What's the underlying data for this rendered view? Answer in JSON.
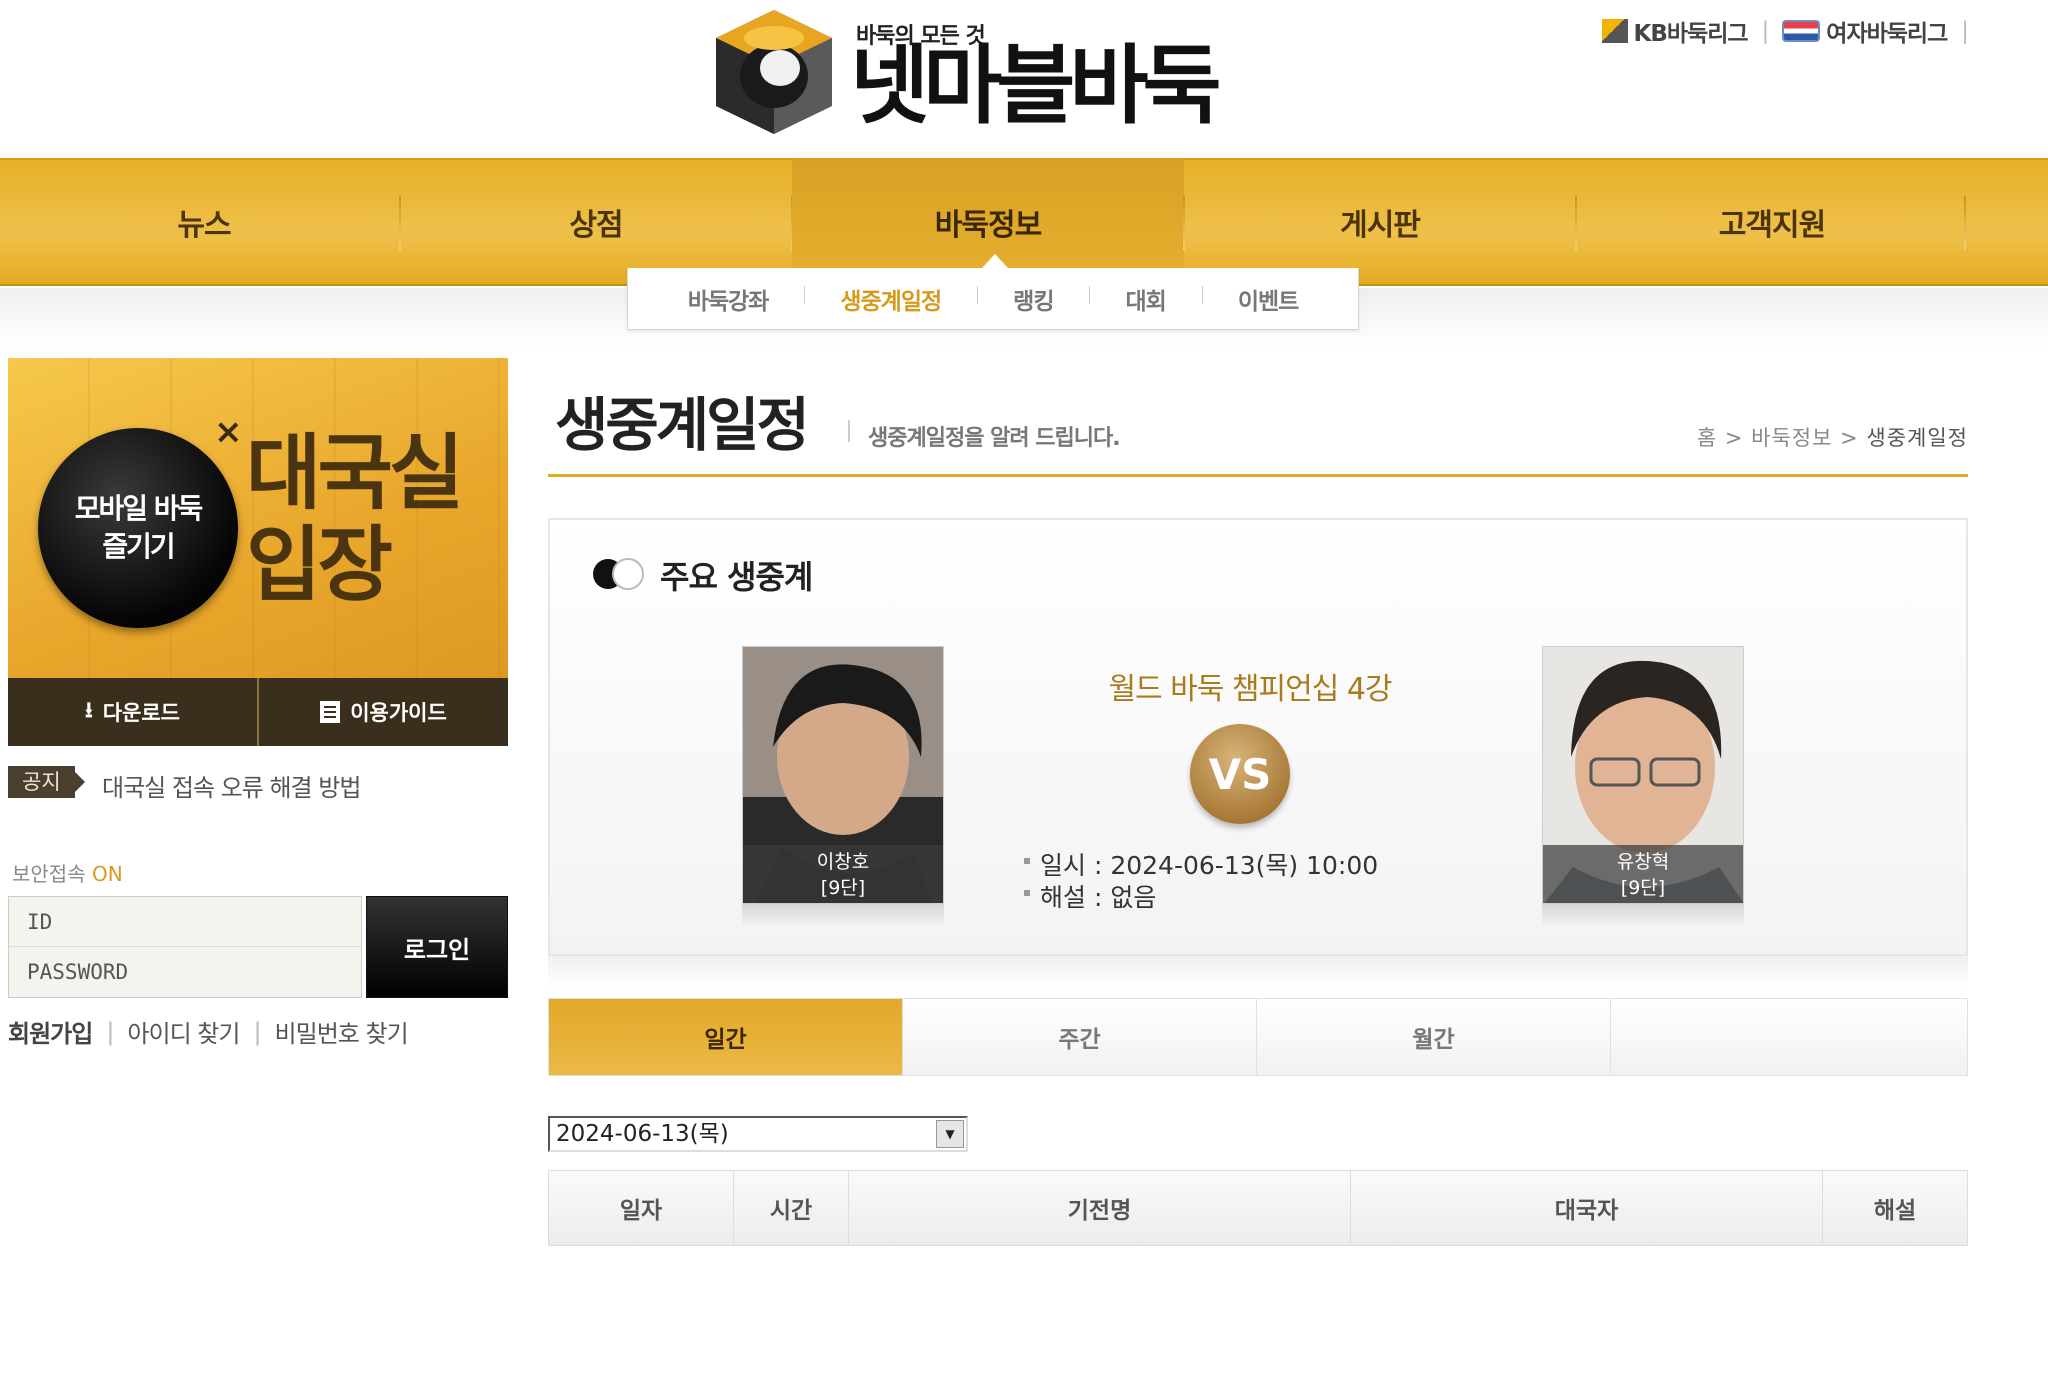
{
  "header": {
    "tagline": "바둑의 모든 것",
    "logo_text": "넷마블바둑",
    "links": [
      "KB바둑리그",
      "여자바둑리그"
    ]
  },
  "nav": {
    "items": [
      "뉴스",
      "상점",
      "바둑정보",
      "게시판",
      "고객지원"
    ],
    "active": "바둑정보",
    "sub_items": [
      "바둑강좌",
      "생중계일정",
      "랭킹",
      "대회",
      "이벤트"
    ],
    "sub_active": "생중계일정"
  },
  "banner": {
    "circle_line1": "모바일 바둑",
    "circle_line2": "즐기기",
    "close": "×",
    "title_line1": "대국실",
    "title_line2": "입장",
    "download": "다운로드",
    "guide": "이용가이드"
  },
  "notice": {
    "badge": "공지",
    "text": "대국실 접속 오류 해결 방법"
  },
  "login": {
    "secure_label": "보안접속",
    "secure_state": "ON",
    "id_placeholder": "ID",
    "password_placeholder": "PASSWORD",
    "button": "로그인",
    "links": [
      "회원가입",
      "아이디 찾기",
      "비밀번호 찾기"
    ]
  },
  "page": {
    "title": "생중계일정",
    "description": "생중계일정을 알려 드립니다.",
    "breadcrumb": [
      "홈",
      "바둑정보",
      "생중계일정"
    ]
  },
  "featured": {
    "heading": "주요 생중계",
    "match_title": "월드 바둑 챔피언십 4강",
    "vs": "VS",
    "player1": {
      "name": "이창호",
      "rank": "[9단]"
    },
    "player2": {
      "name": "유창혁",
      "rank": "[9단]"
    },
    "datetime_label": "일시",
    "datetime_value": "2024-06-13(목) 10:00",
    "commentary_label": "해설",
    "commentary_value": "없음"
  },
  "tabs": {
    "items": [
      "일간",
      "주간",
      "월간"
    ],
    "active": "일간"
  },
  "date_select": {
    "value": "2024-06-13(목)"
  },
  "schedule_table": {
    "headers": [
      "일자",
      "시간",
      "기전명",
      "대국자",
      "해설"
    ]
  },
  "colors": {
    "accent": "#e5ac21",
    "accent_text": "#d89a1c",
    "dark": "#3a2f1c"
  }
}
